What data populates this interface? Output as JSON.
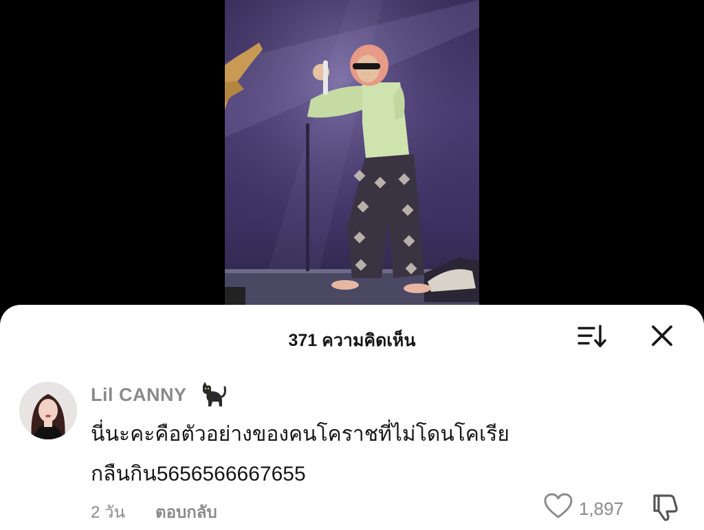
{
  "header": {
    "title": "371 ความคิดเห็น",
    "sort_icon": "sort-icon",
    "close_icon": "close-icon"
  },
  "comment": {
    "username": "Lil CANNY",
    "username_emoji": "cat-icon",
    "text_line1": "นี่นะคะคือตัวอย่างของคนโคราชที่ไม่โดนโคเรีย",
    "text_line2": "กลืนกิน5656566667655",
    "time": "2 วัน",
    "reply_label": "ตอบกลับ",
    "like_count": "1,897",
    "like_icon": "heart-icon",
    "dislike_icon": "thumbs-down-icon"
  },
  "colors": {
    "background": "#000000",
    "sheet": "#ffffff",
    "primary_text": "#161616",
    "secondary_text": "#8a8a8a"
  }
}
